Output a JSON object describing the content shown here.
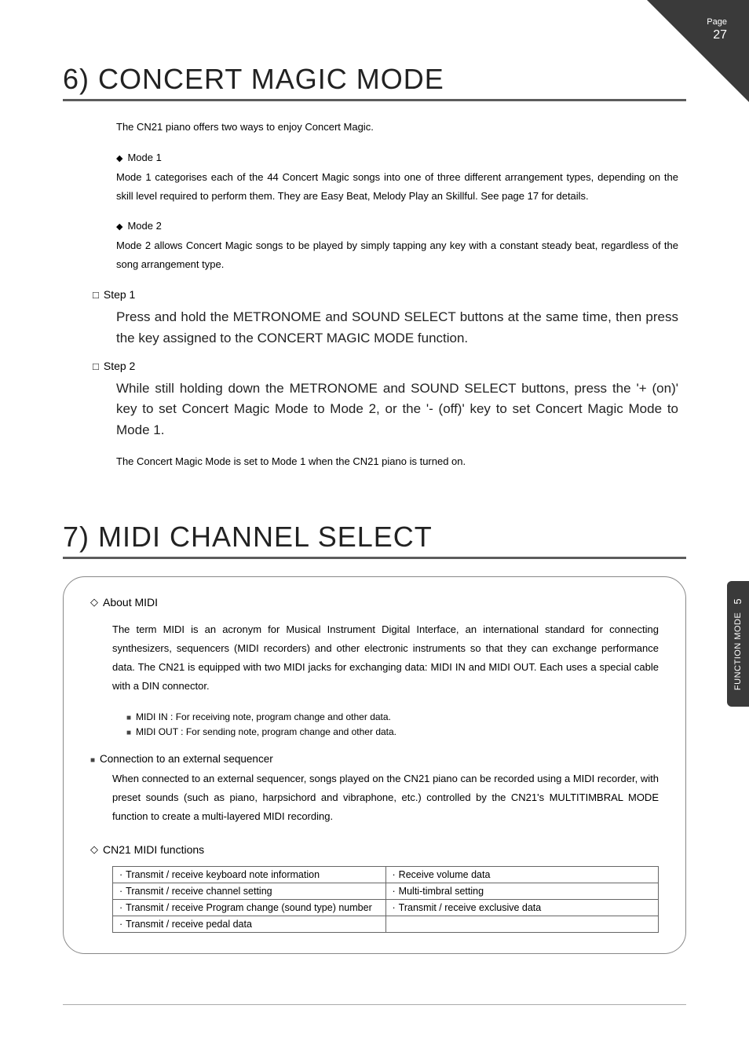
{
  "page": {
    "label": "Page",
    "number": "27"
  },
  "sideTab": {
    "text": "FUNCTION MODE",
    "chapter": "5"
  },
  "section6": {
    "title": "6) CONCERT MAGIC MODE",
    "intro": "The CN21 piano offers two ways to enjoy Concert Magic.",
    "mode1": {
      "label": "Mode 1",
      "text": "Mode 1 categorises each of the 44 Concert Magic songs into one of three different arrangement types, depending on the skill level required to perform them.  They are Easy Beat, Melody Play an Skillful.  See page 17 for details."
    },
    "mode2": {
      "label": "Mode 2",
      "text": "Mode 2 allows Concert Magic songs to be played by simply tapping any key with a constant steady beat, regardless of the song arrangement type."
    },
    "step1": {
      "label": "Step 1",
      "text": "Press and hold the METRONOME and SOUND SELECT buttons at the same time, then press the key assigned to the CONCERT MAGIC MODE function."
    },
    "step2": {
      "label": "Step 2",
      "text": "While still holding down the METRONOME and SOUND SELECT buttons, press the '+ (on)' key to set Concert Magic Mode to Mode 2, or the '- (off)' key to set Concert Magic Mode to Mode 1."
    },
    "footnote": "The Concert Magic Mode is set to Mode 1 when the CN21 piano is turned on."
  },
  "section7": {
    "title": "7) MIDI CHANNEL SELECT",
    "about": {
      "heading": "About MIDI",
      "body": "The term MIDI is an acronym for Musical Instrument Digital Interface, an international standard for connecting synthesizers, sequencers (MIDI recorders) and other electronic instruments so that they can exchange performance data. The CN21 is equipped with two MIDI jacks for exchanging data: MIDI IN and MIDI OUT. Each uses a special cable with a DIN connector.",
      "midiIn": "MIDI IN : For receiving note, program change and other data.",
      "midiOut": "MIDI OUT : For sending note, program change and other data."
    },
    "connection": {
      "heading": "Connection to an external sequencer",
      "body": "When connected to an external sequencer, songs played on the CN21 piano can be recorded using a MIDI recorder, with preset sounds (such as piano, harpsichord and vibraphone, etc.) controlled by the CN21's MULTITIMBRAL MODE function to create a multi-layered MIDI recording."
    },
    "functions": {
      "heading": "CN21 MIDI functions",
      "rows": [
        [
          "Transmit / receive keyboard note information",
          "Receive volume data"
        ],
        [
          "Transmit / receive channel setting",
          "Multi-timbral setting"
        ],
        [
          "Transmit / receive Program change (sound type) number",
          "Transmit / receive exclusive data"
        ],
        [
          "Transmit / receive pedal data",
          ""
        ]
      ]
    }
  }
}
